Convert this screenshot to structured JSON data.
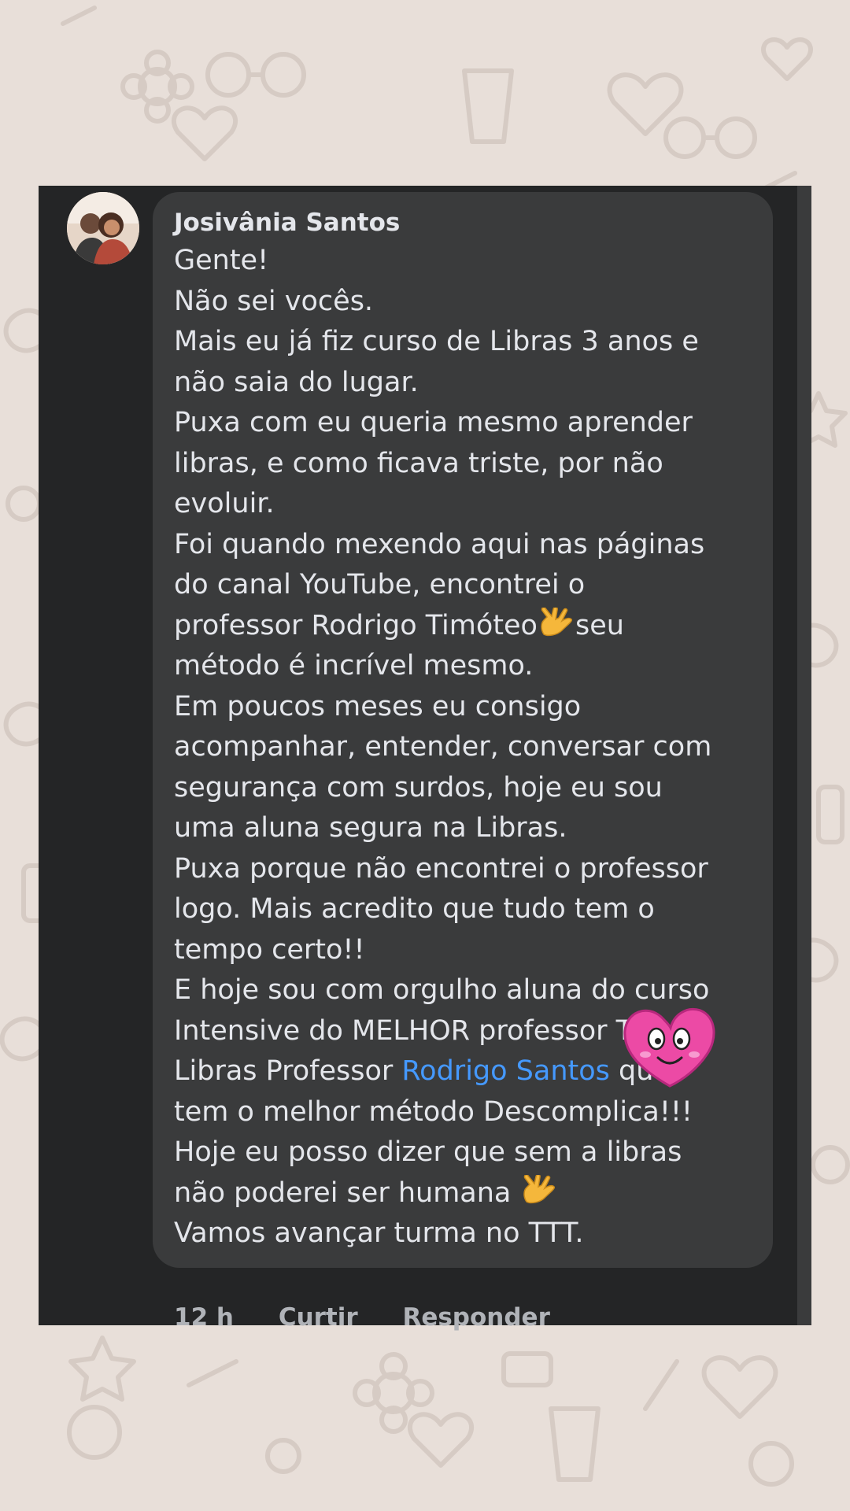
{
  "comment": {
    "author": "Josivânia Santos",
    "lines": [
      "Gente!",
      "Não sei vocês.",
      "Mais eu já fiz curso de Libras 3 anos e",
      "não saia do lugar.",
      "Puxa com eu queria mesmo aprender",
      "libras, e como ficava triste, por não",
      "evoluir.",
      "Foi quando mexendo aqui nas páginas",
      "do canal YouTube, encontrei o",
      "professor Rodrigo Timóteo",
      "seu",
      "método é incrível mesmo.",
      "Em poucos meses eu consigo",
      "acompanhar, entender, conversar com",
      "segurança com surdos, hoje eu sou",
      "uma aluna segura na Libras.",
      "Puxa porque não encontrei o professor",
      "logo. Mais acredito que tudo tem o",
      "tempo certo!!",
      "E hoje sou com orgulho aluna do curso",
      "Intensive do MELHOR professor Top de",
      "Libras Professor ",
      "Rodrigo Santos",
      " que",
      "tem o melhor método Descomplica!!!",
      "Hoje eu posso dizer que sem a libras",
      "não poderei ser humana ",
      "Vamos avançar turma no TTT."
    ],
    "icons": {
      "hand_sign": "love-you-hand-icon",
      "sticker": "pink-heart-face-sticker"
    }
  },
  "actions": {
    "time": "12 h",
    "like": "Curtir",
    "reply": "Responder"
  },
  "colors": {
    "page_background": "#e8dfd9",
    "card_background": "#242526",
    "bubble_background": "#3a3b3c",
    "text": "#e4e6eb",
    "link": "#4599ff",
    "meta": "#b0b3b8",
    "heart": "#ec4aa5"
  }
}
